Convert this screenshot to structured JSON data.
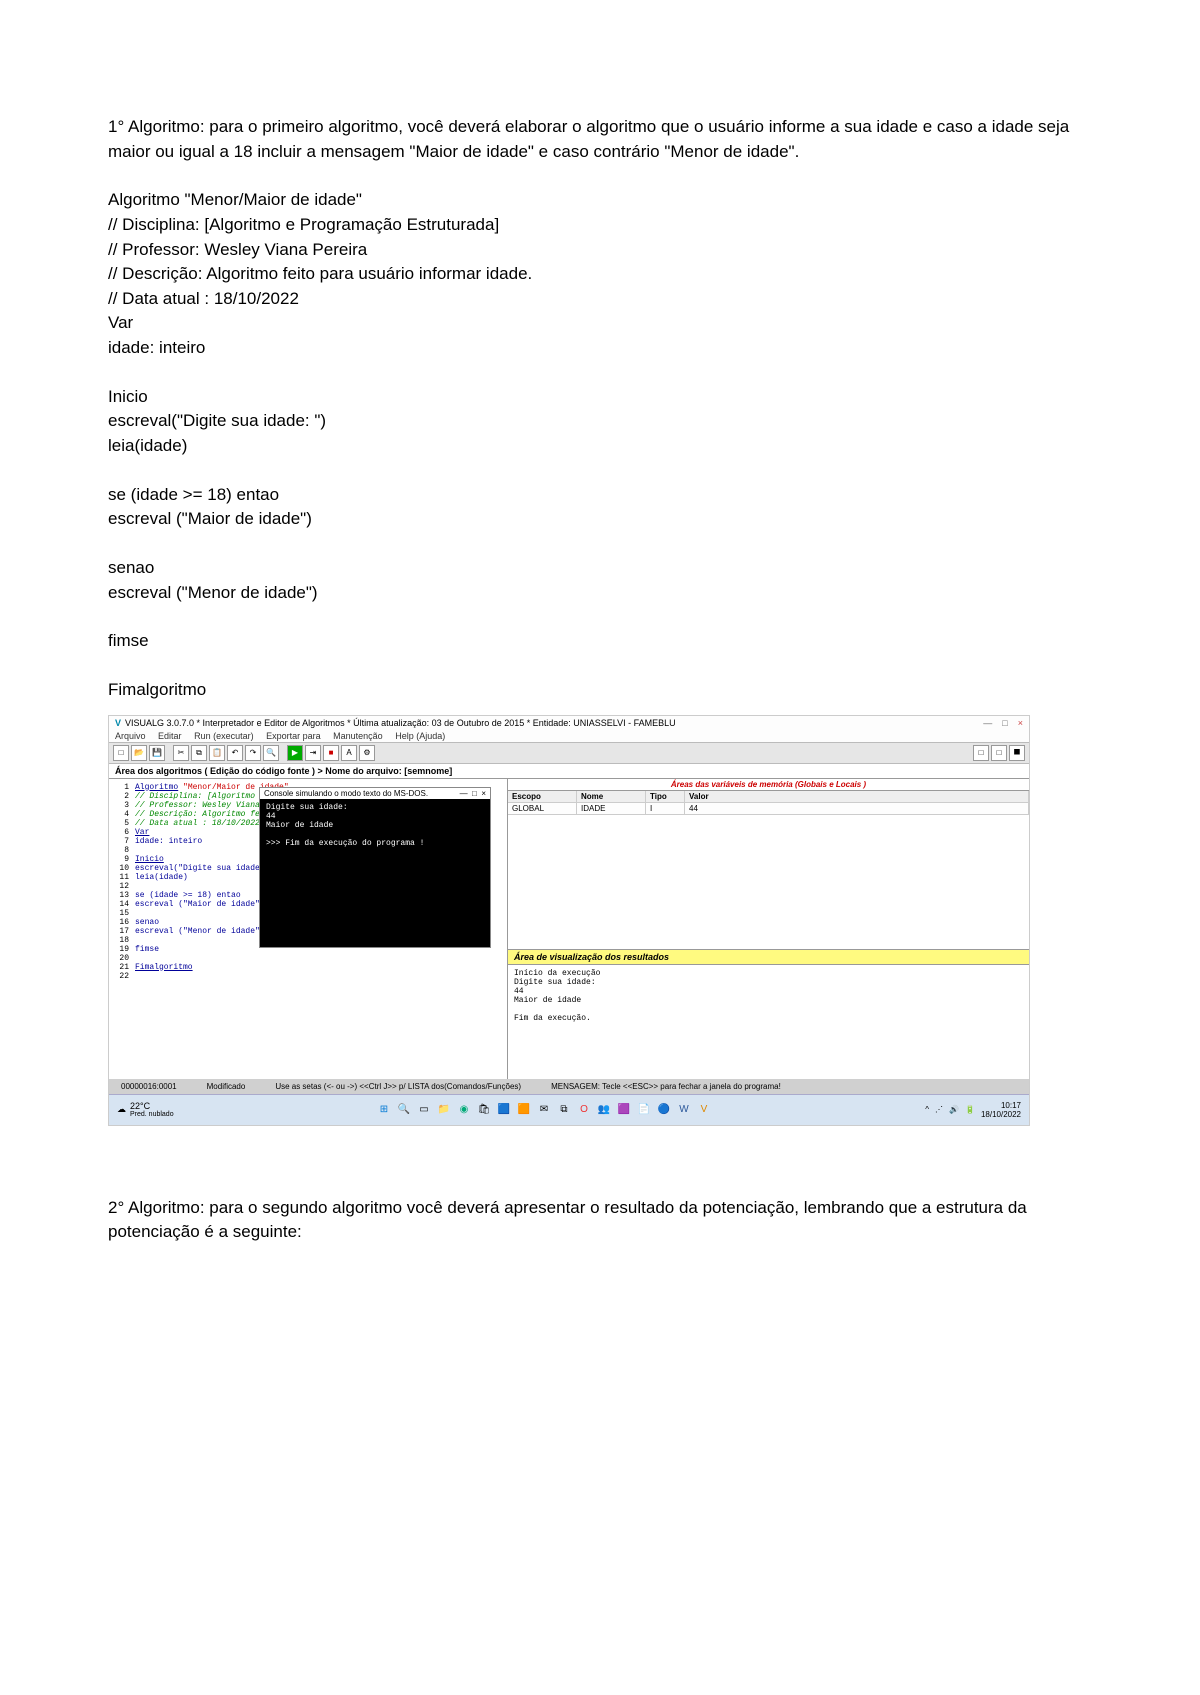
{
  "doc": {
    "p1": "1° Algoritmo: para o primeiro algoritmo, você deverá elaborar o algoritmo que o usuário informe a sua idade e caso a idade seja maior ou igual a 18 incluir a mensagem \"Maior de idade\" e caso contrário \"Menor de idade\".",
    "code": {
      "l1": "Algoritmo \"Menor/Maior de idade\"",
      "l2": "// Disciplina: [Algoritmo e Programação Estruturada]",
      "l3": "// Professor:  Wesley Viana Pereira",
      "l4": "// Descrição: Algoritmo feito para usuário informar idade.",
      "l5": "// Data atual  : 18/10/2022",
      "l6": "Var",
      "l7": "idade: inteiro",
      "l8": "Inicio",
      "l9": "escreval(\"Digite sua idade: \")",
      "l10": "leia(idade)",
      "l11": "se (idade >= 18) entao",
      "l12": "escreval (\"Maior de idade\")",
      "l13": "senao",
      "l14": "escreval (\"Menor de idade\")",
      "l15": "fimse",
      "l16": "Fimalgoritmo"
    },
    "p2": "2° Algoritmo: para o segundo algoritmo você deverá apresentar o resultado da potenciação, lembrando que a estrutura da potenciação é a seguinte:"
  },
  "visualg": {
    "title": "VISUALG 3.0.7.0 * Interpretador e Editor de Algoritmos * Última atualização: 03 de Outubro de 2015 * Entidade: UNIASSELVI - FAMEBLU",
    "menu": [
      "Arquivo",
      "Editar",
      "Run (executar)",
      "Exportar para",
      "Manutenção",
      "Help (Ajuda)"
    ],
    "filebar": "Área dos algoritmos ( Edição do código fonte )  > Nome do arquivo: [semnome]",
    "code": [
      {
        "n": "1",
        "kw": "Algoritmo",
        "rest": " \"Menor/Maior de idade\"",
        "cls": "str"
      },
      {
        "n": "2",
        "txt": "// Disciplina: [Algoritmo e Programação Estruturada]",
        "cls": "cmt"
      },
      {
        "n": "3",
        "txt": "// Professor:  Wesley Viana Pereira",
        "cls": "cmt"
      },
      {
        "n": "4",
        "txt": "// Descrição: Algoritmo feito para usuário informar idade.",
        "cls": "cmt"
      },
      {
        "n": "5",
        "txt": "// Data atual  : 18/10/2022",
        "cls": "cmt"
      },
      {
        "n": "6",
        "txt": "Var",
        "cls": "kw under"
      },
      {
        "n": "7",
        "txt": "idade: inteiro",
        "cls": "kw"
      },
      {
        "n": "8",
        "txt": "",
        "cls": ""
      },
      {
        "n": "9",
        "txt": "Inicio",
        "cls": "kw under"
      },
      {
        "n": "10",
        "txt": "escreval(\"Digite sua idade: \")",
        "cls": "kw"
      },
      {
        "n": "11",
        "txt": "leia(idade)",
        "cls": "kw"
      },
      {
        "n": "12",
        "txt": "",
        "cls": ""
      },
      {
        "n": "13",
        "txt": "se (idade >= 18) entao",
        "cls": "kw"
      },
      {
        "n": "14",
        "txt": "escreval (\"Maior de idade\")",
        "cls": "kw"
      },
      {
        "n": "15",
        "txt": "",
        "cls": ""
      },
      {
        "n": "16",
        "txt": "senao",
        "cls": "kw"
      },
      {
        "n": "17",
        "txt": "escreval (\"Menor de idade\")",
        "cls": "kw"
      },
      {
        "n": "18",
        "txt": "",
        "cls": ""
      },
      {
        "n": "19",
        "txt": "fimse",
        "cls": "kw"
      },
      {
        "n": "20",
        "txt": "",
        "cls": ""
      },
      {
        "n": "21",
        "txt": "Fimalgoritmo",
        "cls": "kw under"
      },
      {
        "n": "22",
        "txt": "",
        "cls": ""
      }
    ],
    "console": {
      "title": "Console simulando o modo texto do MS-DOS.",
      "l1": "Digite sua idade:",
      "l2": "44",
      "l3": "Maior de idade",
      "l4": ">>> Fim da execução do programa !"
    },
    "vars": {
      "title": "Áreas das variáveis de memória (Globais e Locais )",
      "headers": [
        "Escopo",
        "Nome",
        "Tipo",
        "Valor"
      ],
      "row": [
        "GLOBAL",
        "IDADE",
        "I",
        "44"
      ]
    },
    "results": {
      "title": "Área de visualização dos resultados",
      "body": "Início da execução\nDigite sua idade:\n44\nMaior de idade\n\nFim da execução."
    },
    "status": {
      "pos": "00000016:0001",
      "mod": "Modificado",
      "hint": "Use as setas (<- ou ->) <<Ctrl J>> p/ LISTA dos(Comandos/Funções)",
      "msg": "MENSAGEM: Tecle <<ESC>> para fechar a janela do programa!"
    },
    "taskbar": {
      "temp": "22°C",
      "weather": "Pred. nublado",
      "time": "10:17",
      "date": "18/10/2022"
    }
  }
}
